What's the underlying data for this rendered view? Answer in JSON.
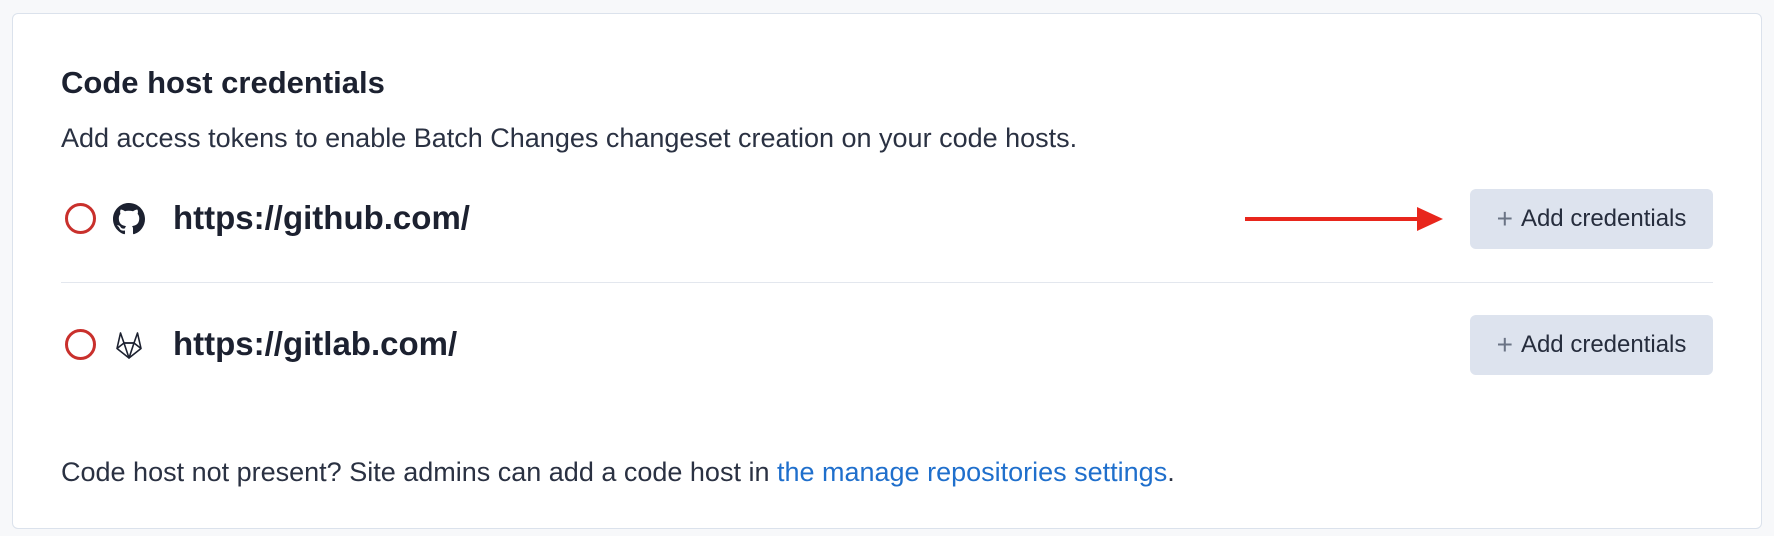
{
  "section": {
    "title": "Code host credentials",
    "description": "Add access tokens to enable Batch Changes changeset creation on your code hosts."
  },
  "hosts": [
    {
      "url": "https://github.com/",
      "icon": "github-icon",
      "status": "no-credentials",
      "button_label": "Add credentials",
      "highlighted": true
    },
    {
      "url": "https://gitlab.com/",
      "icon": "gitlab-icon",
      "status": "no-credentials",
      "button_label": "Add credentials",
      "highlighted": false
    }
  ],
  "footer": {
    "prefix": "Code host not present? Site admins can add a code host in ",
    "link_text": "the manage repositories settings",
    "suffix": "."
  },
  "colors": {
    "status_ring": "#c9302c",
    "button_bg": "#dde3ee",
    "link": "#1f6fcc",
    "annotation_arrow": "#e8261c"
  }
}
